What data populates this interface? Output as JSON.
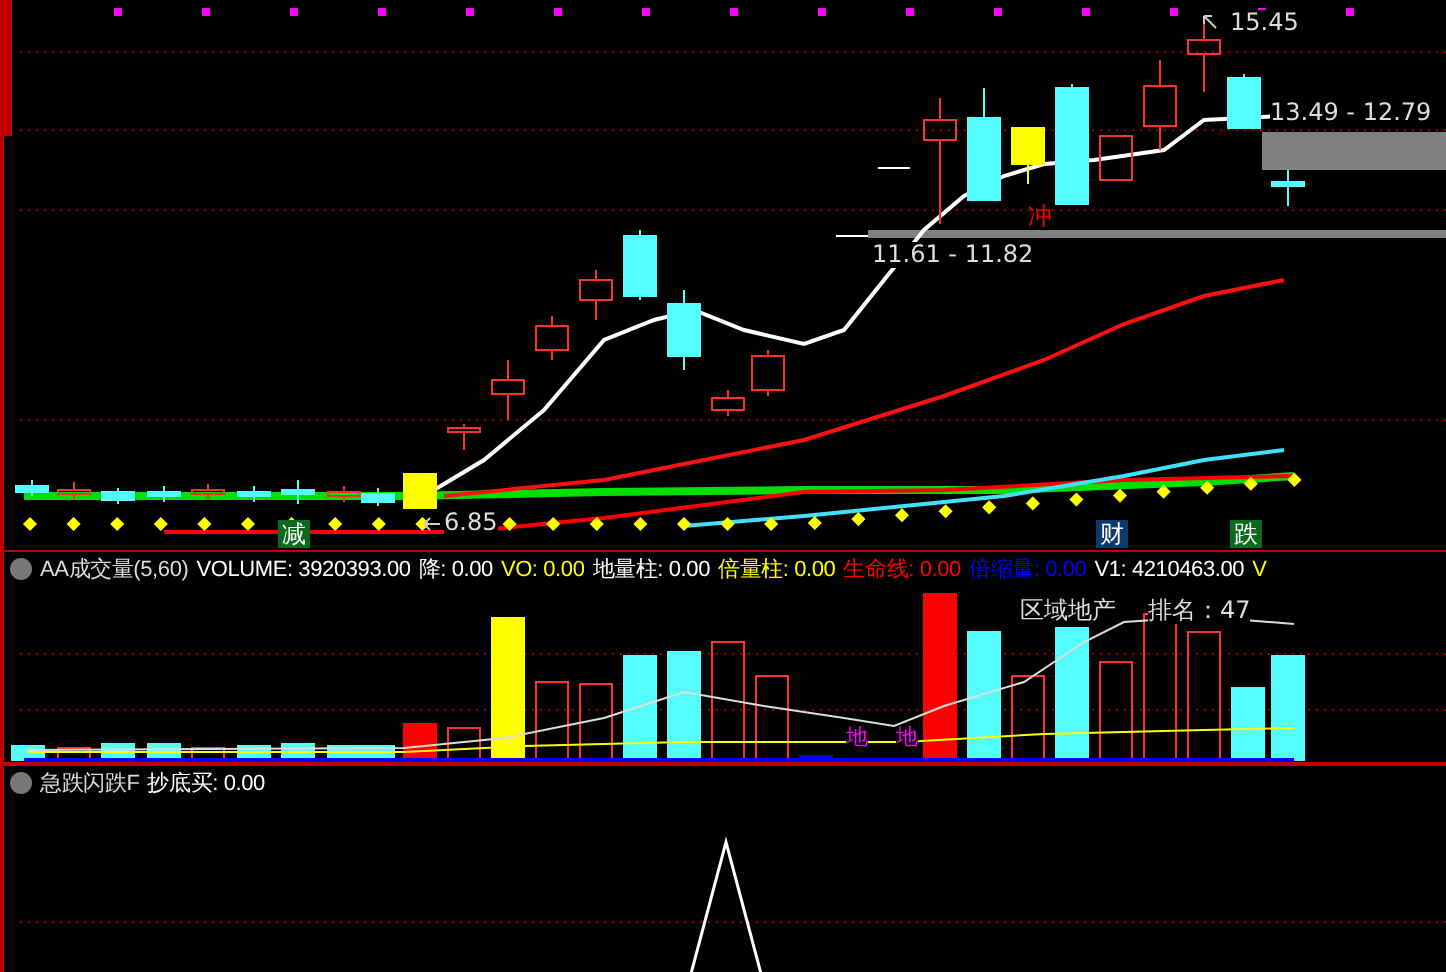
{
  "price_chart": {
    "high_label": "15.45",
    "upper_range_label": "13.49 - 12.79",
    "lower_range_label": "11.61 - 11.82",
    "low_label": "6.85",
    "signals": [
      {
        "kind": "text",
        "text": "冲",
        "color": "#ff0000"
      },
      {
        "kind": "badge",
        "text": "减",
        "color": "#0a6b1e"
      },
      {
        "kind": "badge",
        "text": "财",
        "color": "#0d3a6e"
      },
      {
        "kind": "badge",
        "text": "跌",
        "color": "#0a6b1e"
      }
    ]
  },
  "volume_panel": {
    "title": "AA成交量(5,60)",
    "readings": [
      {
        "text": "VOLUME: 3920393.00",
        "color": "#ffffff"
      },
      {
        "text": "降: 0.00",
        "color": "#ffffff"
      },
      {
        "text": "VO: 0.00",
        "color": "#ffff00"
      },
      {
        "text": "地量柱: 0.00",
        "color": "#ffffff"
      },
      {
        "text": "倍量柱: 0.00",
        "color": "#ffff00"
      },
      {
        "text": "生命线: 0.00",
        "color": "#ff0000"
      },
      {
        "text": "倍缩量: 0.00",
        "color": "#0000ff"
      },
      {
        "text": "V1: 4210463.00",
        "color": "#ffffff"
      },
      {
        "text": "V",
        "color": "#ffff00"
      }
    ],
    "sector": "区域地产",
    "rank": "排名：47",
    "markers": [
      "地",
      "地"
    ]
  },
  "crash_panel": {
    "title": "急跌闪跌F",
    "readings": [
      {
        "text": "抄底买: 0.00",
        "color": "#ffffff"
      }
    ]
  }
}
